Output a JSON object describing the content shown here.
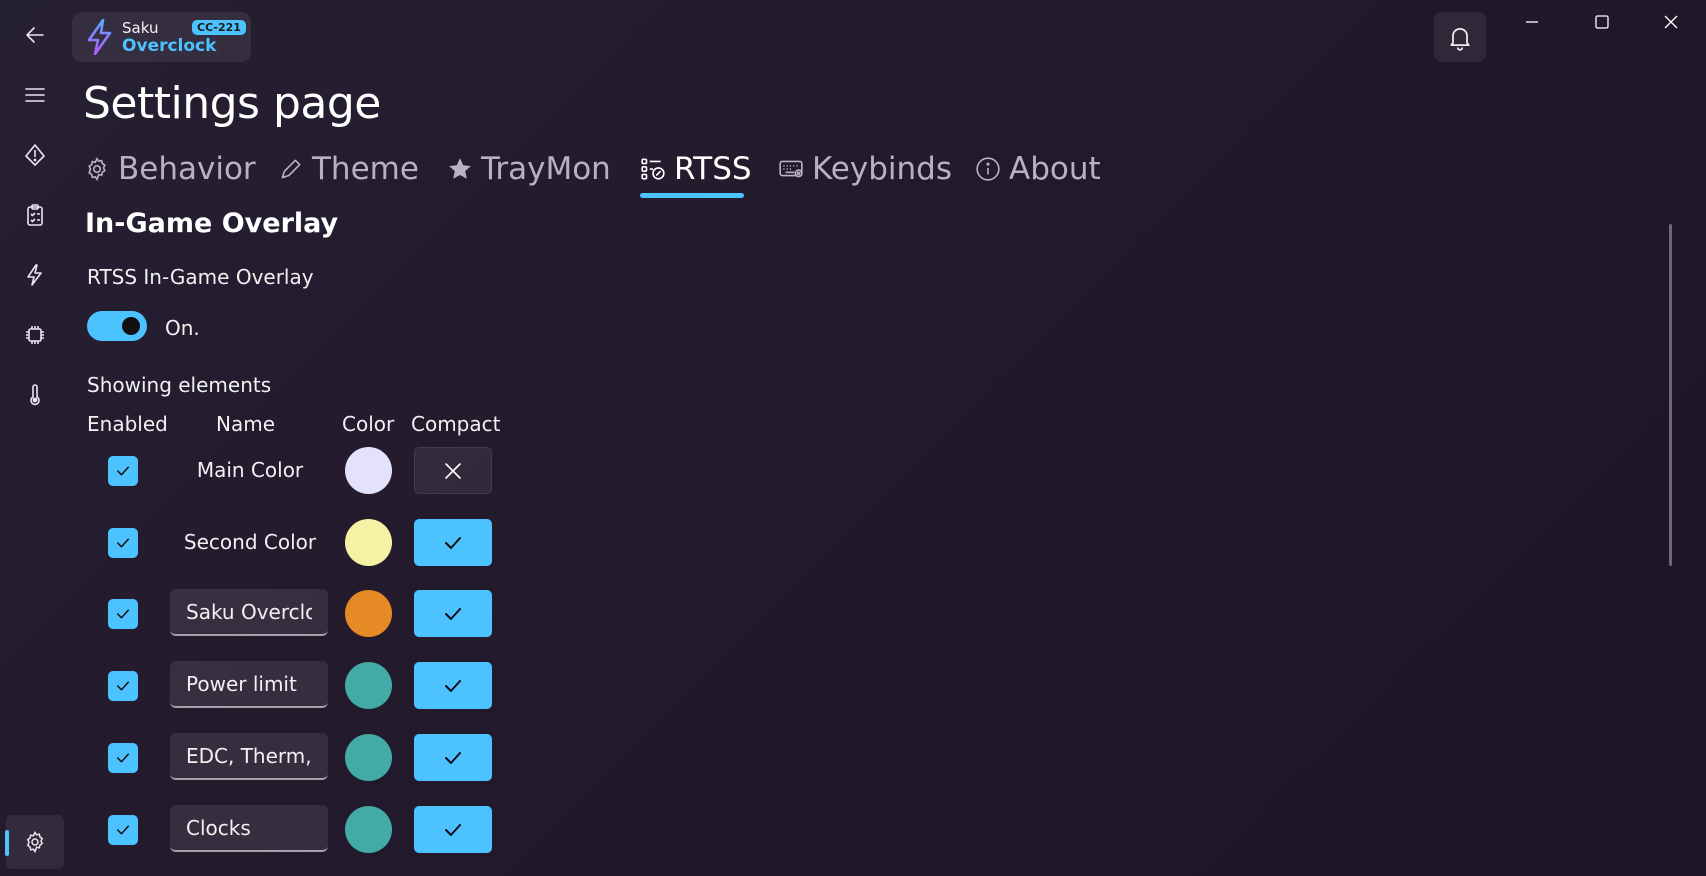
{
  "titlebar": {
    "app_name_line1": "Saku",
    "app_name_line2": "Overclock",
    "version_badge": "CC-221"
  },
  "page": {
    "title": "Settings page"
  },
  "tabs": [
    {
      "label": "Behavior",
      "icon": "gear-icon",
      "active": false
    },
    {
      "label": "Theme",
      "icon": "pen-icon",
      "active": false
    },
    {
      "label": "TrayMon",
      "icon": "star-icon",
      "active": false
    },
    {
      "label": "RTSS",
      "icon": "rtss-icon",
      "active": true
    },
    {
      "label": "Keybinds",
      "icon": "keyboard-icon",
      "active": false
    },
    {
      "label": "About",
      "icon": "info-icon",
      "active": false
    }
  ],
  "overlay": {
    "section_title": "In-Game Overlay",
    "setting_label": "RTSS In-Game Overlay",
    "toggle_on": true,
    "toggle_text": "On.",
    "elements_heading": "Showing elements",
    "columns": {
      "enabled": "Enabled",
      "name": "Name",
      "color": "Color",
      "compact": "Compact"
    },
    "rows": [
      {
        "enabled": true,
        "name": "Main Color",
        "editable": false,
        "color": "#e4e1fb",
        "compact": false
      },
      {
        "enabled": true,
        "name": "Second Color",
        "editable": false,
        "color": "#f4f3a5",
        "compact": true
      },
      {
        "enabled": true,
        "name": "Saku Overclock",
        "editable": true,
        "color": "#e58a25",
        "compact": true
      },
      {
        "enabled": true,
        "name": "Power limit",
        "editable": true,
        "color": "#43aba7",
        "compact": true
      },
      {
        "enabled": true,
        "name": "EDC, Therm, CPU",
        "editable": true,
        "color": "#43aba7",
        "compact": true
      },
      {
        "enabled": true,
        "name": "Clocks",
        "editable": true,
        "color": "#43aba7",
        "compact": true
      }
    ]
  },
  "colors": {
    "accent": "#4cc2ff"
  }
}
